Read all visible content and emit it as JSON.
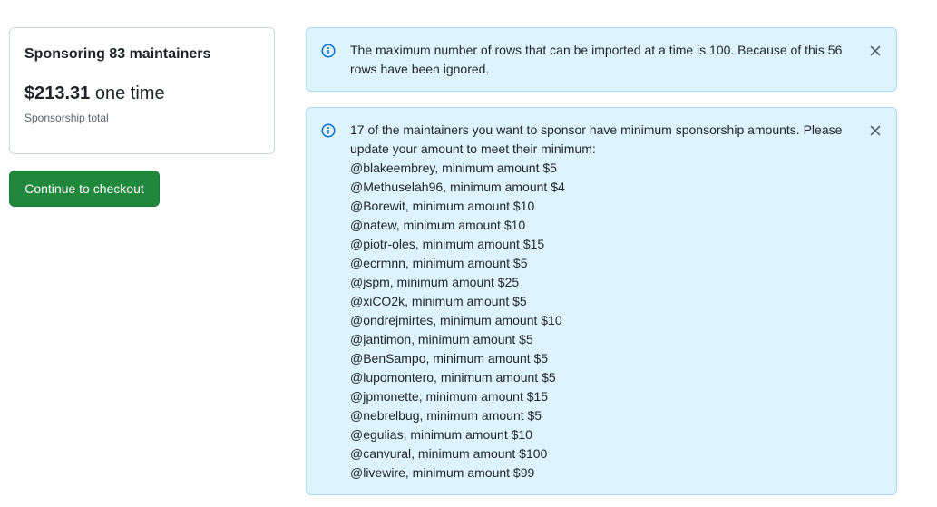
{
  "summary": {
    "title": "Sponsoring 83 maintainers",
    "amount": "$213.31",
    "frequency": "one time",
    "subtitle": "Sponsorship total"
  },
  "checkout": {
    "label": "Continue to checkout"
  },
  "alerts": {
    "rows_limit": {
      "message": "The maximum number of rows that can be imported at a time is 100. Because of this 56 rows have been ignored."
    },
    "minimums": {
      "intro": "17 of the maintainers you want to sponsor have minimum sponsorship amounts. Please update your amount to meet their minimum:",
      "items": [
        "@blakeembrey, minimum amount $5",
        "@Methuselah96, minimum amount $4",
        "@Borewit, minimum amount $10",
        "@natew, minimum amount $10",
        "@piotr-oles, minimum amount $15",
        "@ecrmnn, minimum amount $5",
        "@jspm, minimum amount $25",
        "@xiCO2k, minimum amount $5",
        "@ondrejmirtes, minimum amount $10",
        "@jantimon, minimum amount $5",
        "@BenSampo, minimum amount $5",
        "@lupomontero, minimum amount $5",
        "@jpmonette, minimum amount $15",
        "@nebrelbug, minimum amount $5",
        "@egulias, minimum amount $10",
        "@canvural, minimum amount $100",
        "@livewire, minimum amount $99"
      ]
    }
  },
  "icons": {
    "info": "info-icon",
    "close": "close-icon"
  },
  "colors": {
    "checkout_button": "#1f883d",
    "alert_background": "#ddf4ff",
    "alert_border": "#a8d8f3",
    "info_icon": "#0969da"
  }
}
